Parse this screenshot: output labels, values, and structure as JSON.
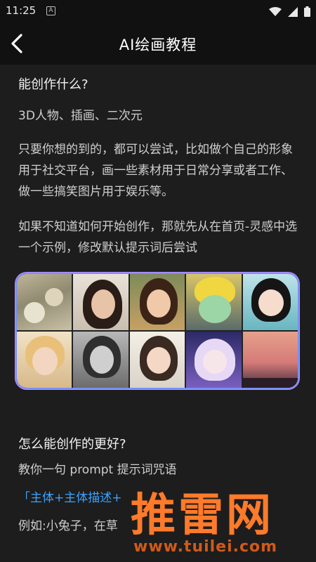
{
  "status": {
    "time": "11:25",
    "notif_letter": "A"
  },
  "header": {
    "title": "AI绘画教程"
  },
  "content": {
    "q1": "能创作什么?",
    "a1": "3D人物、插画、二次元",
    "para1": "只要你想的到的，都可以尝试，比如做个自己的形象用于社交平台，画一些素材用于日常分享或者工作、做一些搞笑图片用于娱乐等。",
    "para2": "如果不知道如何开始创作，那就先从在首页-灵感中选一个示例，修改默认提示词后尝试",
    "q2": "怎么能创作的更好?",
    "para3": "教你一句 prompt 提示词咒语",
    "formula": "「主体+主体描述+",
    "example": "例如:小兔子，在草"
  },
  "watermark": {
    "text": "推雷网",
    "url": "www.tuilei.com"
  },
  "colors": {
    "background": "#1d1d1d",
    "accent_blue": "#3aa3ff",
    "watermark_orange": "#ff7a2a"
  },
  "icons": [
    "chevron-left-icon",
    "wifi-icon",
    "signal-icon",
    "battery-icon"
  ]
}
